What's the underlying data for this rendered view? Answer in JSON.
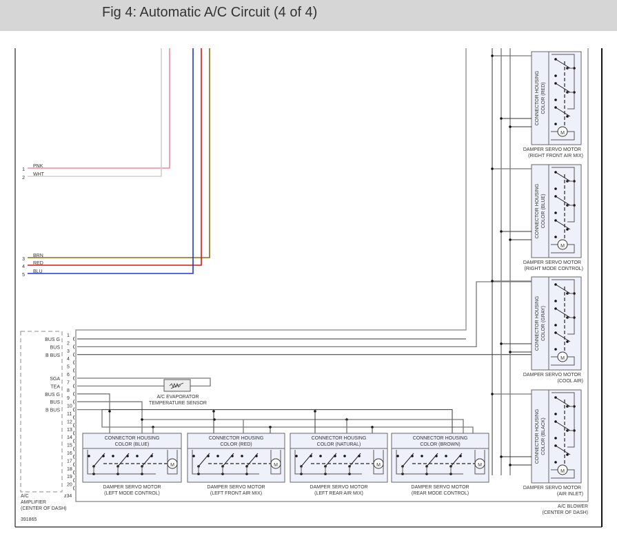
{
  "header": {
    "title": "Fig 4: Automatic A/C Circuit (4 of 4)"
  },
  "wires": [
    {
      "pin": "1",
      "color_name": "PNK",
      "hex": "#f08aa0"
    },
    {
      "pin": "2",
      "color_name": "WHT",
      "hex": "#cfcfcf"
    },
    {
      "pin": "3",
      "color_name": "BRN",
      "hex": "#8a6a10"
    },
    {
      "pin": "4",
      "color_name": "RED",
      "hex": "#e01010"
    },
    {
      "pin": "5",
      "color_name": "BLU",
      "hex": "#2233dd"
    }
  ],
  "amplifier": {
    "name1": "A/C",
    "name2": "AMPLIFIER",
    "location": "(CENTER OF DASH)",
    "connector": "z34",
    "pins": [
      "1",
      "2",
      "3",
      "4",
      "5",
      "6",
      "7",
      "8",
      "9",
      "10",
      "11",
      "12",
      "13",
      "14",
      "15",
      "16",
      "17",
      "18",
      "19",
      "20"
    ],
    "pin_labels": [
      "BUS G",
      "BUS",
      "B BUS",
      "",
      "",
      "SGA",
      "TEA",
      "BUS G",
      "BUS",
      "B BUS"
    ]
  },
  "sensor": {
    "line1": "A/C EVAPORATOR",
    "line2": "TEMPERATURE SENSOR"
  },
  "motor_label": "M",
  "bottom_servos": [
    {
      "housing": "CONNECTOR HOUSING",
      "color": "COLOR (BLUE)",
      "name": "DAMPER SERVO MOTOR",
      "function": "(LEFT MODE CONTROL)"
    },
    {
      "housing": "CONNECTOR HOUSING",
      "color": "COLOR (RED)",
      "name": "DAMPER SERVO MOTOR",
      "function": "(LEFT FRONT AIR MIX)"
    },
    {
      "housing": "CONNECTOR HOUSING",
      "color": "COLOR (NATURAL)",
      "name": "DAMPER SERVO MOTOR",
      "function": "(LEFT REAR AIR MIX)"
    },
    {
      "housing": "CONNECTOR HOUSING",
      "color": "COLOR (BROWN)",
      "name": "DAMPER SERVO MOTOR",
      "function": "(REAR MODE CONTROL)"
    }
  ],
  "right_servos": [
    {
      "housing": "CONNECTOR HOUSING",
      "color": "COLOR (RED)",
      "name": "DAMPER SERVO MOTOR",
      "function": "(RIGHT FRONT AIR MIX)"
    },
    {
      "housing": "CONNECTOR HOUSING",
      "color": "COLOR (BLUE)",
      "name": "DAMPER SERVO MOTOR",
      "function": "(RIGHT MODE CONTROL)"
    },
    {
      "housing": "CONNECTOR HOUSING",
      "color": "COLOR (GRAY)",
      "name": "DAMPER SERVO MOTOR",
      "function": "(COOL AIR)"
    },
    {
      "housing": "CONNECTOR HOUSING",
      "color": "COLOR (BLACK)",
      "name": "DAMPER SERVO MOTOR",
      "function": "(AIR INLET)"
    }
  ],
  "blower": {
    "name": "A/C BLOWER",
    "location": "(CENTER OF DASH)"
  },
  "figure_id": "391865"
}
